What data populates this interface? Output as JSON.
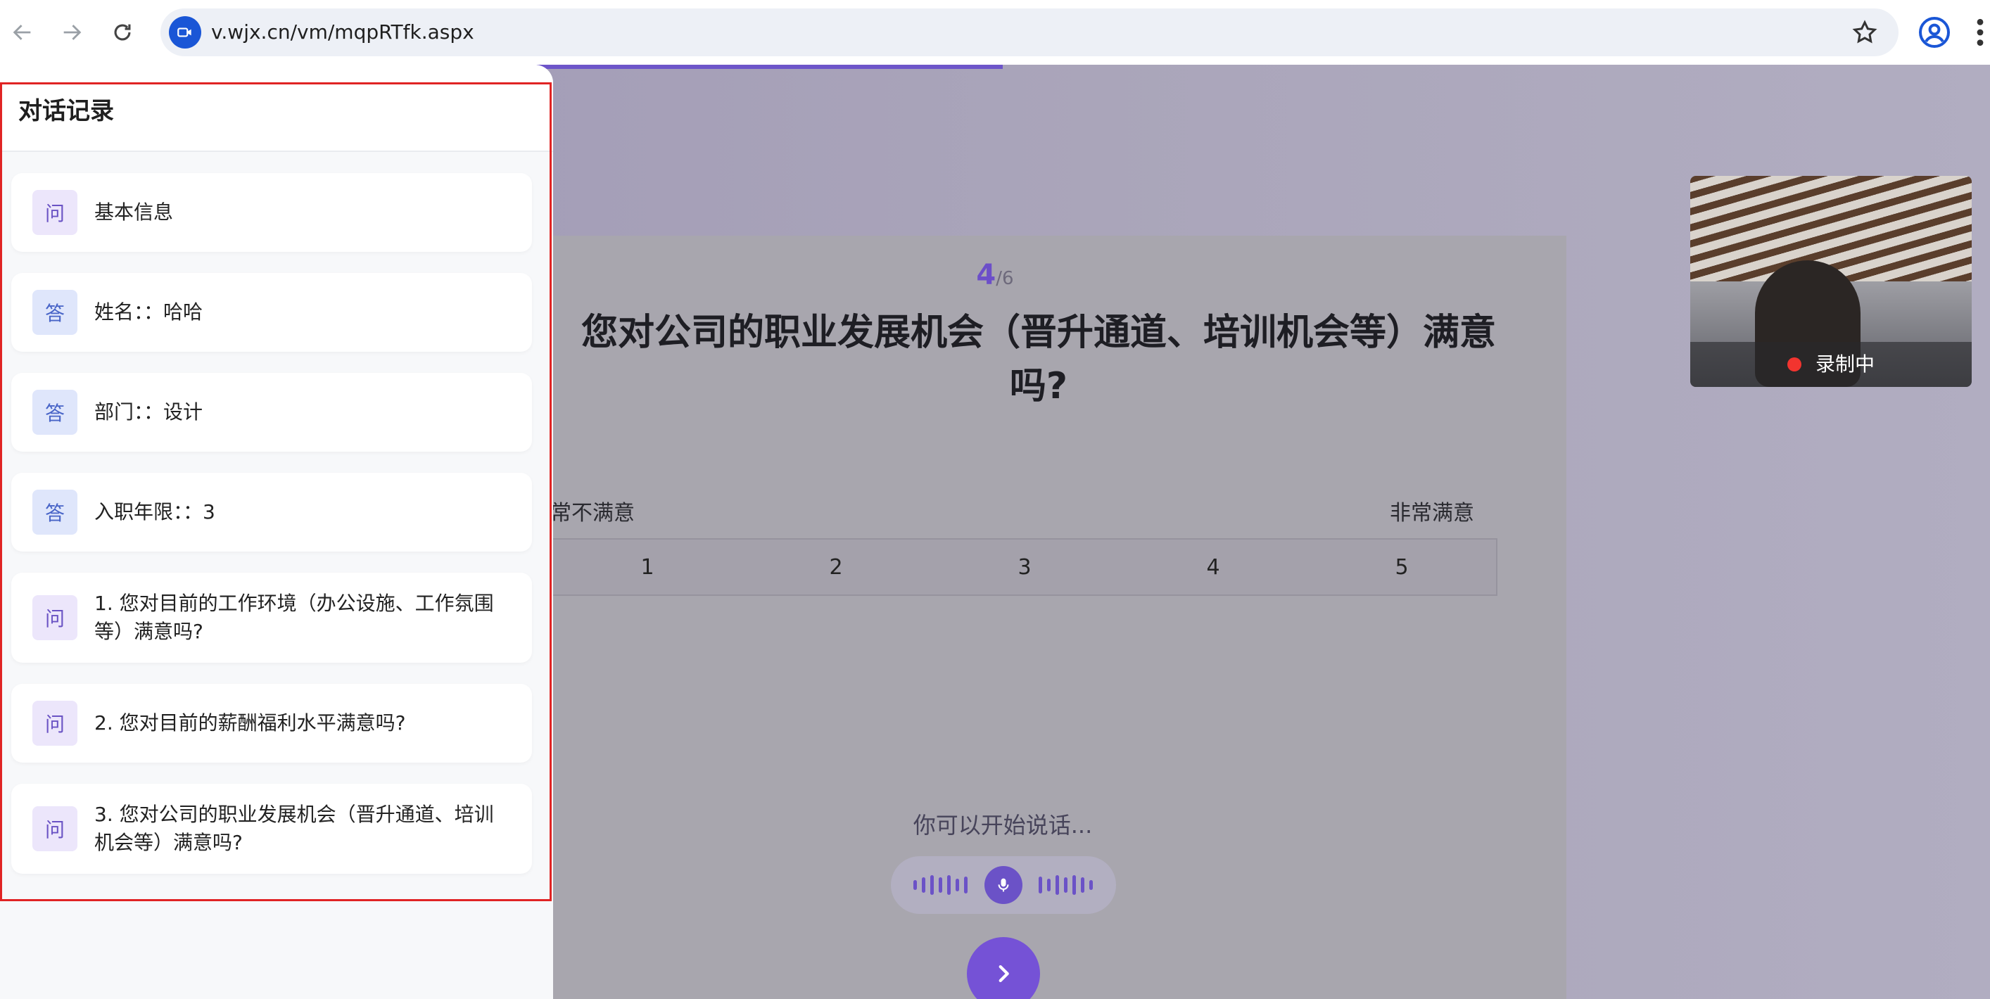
{
  "browser": {
    "url": "v.wjx.cn/vm/mqpRTfk.aspx"
  },
  "chat_panel": {
    "title": "对话记录",
    "messages": [
      {
        "role": "问",
        "text": "基本信息"
      },
      {
        "role": "答",
        "text": "姓名：：哈哈"
      },
      {
        "role": "答",
        "text": "部门：：设计"
      },
      {
        "role": "答",
        "text": "入职年限：：3"
      },
      {
        "role": "问",
        "text": "1. 您对目前的工作环境（办公设施、工作氛围等）满意吗?"
      },
      {
        "role": "问",
        "text": "2. 您对目前的薪酬福利水平满意吗?"
      },
      {
        "role": "问",
        "text": "3. 您对公司的职业发展机会（晋升通道、培训机会等）满意吗?"
      }
    ]
  },
  "survey": {
    "progress_fraction": 0.6667,
    "current": "4",
    "total": "/6",
    "question": "您对公司的职业发展机会（晋升通道、培训机会等）满意吗?",
    "scale_left_label": "常不满意",
    "scale_right_label": "非常满意",
    "scale_options": [
      "1",
      "2",
      "3",
      "4",
      "5"
    ],
    "voice_hint": "你可以开始说话..."
  },
  "camera": {
    "status": "录制中"
  },
  "colors": {
    "accent": "#6d55c9",
    "record": "#f2342f",
    "highlight_border": "#e02424"
  }
}
